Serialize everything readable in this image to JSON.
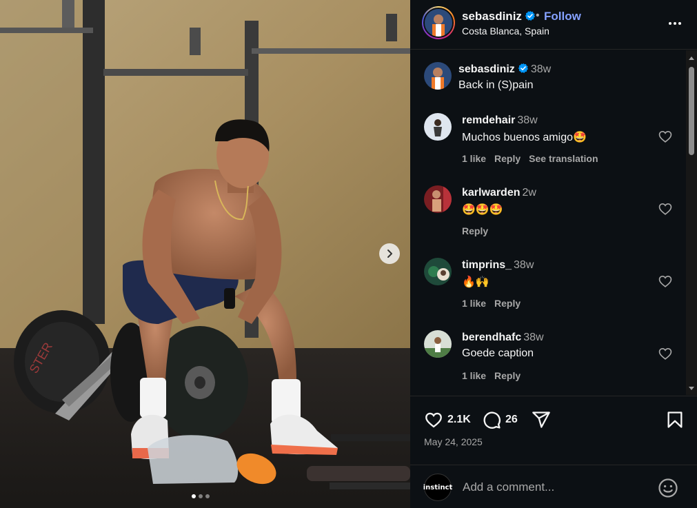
{
  "post": {
    "username": "sebasdiniz",
    "separator": "•",
    "follow_label": "Follow",
    "location": "Costa Blanca, Spain",
    "caption_user": "sebasdiniz",
    "caption_time": "38w",
    "caption_text": "Back in (S)pain",
    "likes": "2.1K",
    "comments_count": "26",
    "date": "May 24, 2025"
  },
  "comments": [
    {
      "user": "remdehair",
      "time": "38w",
      "text": "Muchos buenos amigo🤩",
      "likes": "1 like",
      "reply": "Reply",
      "translate": "See translation"
    },
    {
      "user": "karlwarden",
      "time": "2w",
      "text": "🤩🤩🤩",
      "likes": "",
      "reply": "Reply",
      "translate": ""
    },
    {
      "user": "timprins_",
      "time": "38w",
      "text": "🔥🙌",
      "likes": "1 like",
      "reply": "Reply",
      "translate": ""
    },
    {
      "user": "berendhafc",
      "time": "38w",
      "text": "Goede caption",
      "likes": "1 like",
      "reply": "Reply",
      "translate": ""
    }
  ],
  "composer": {
    "placeholder": "Add a comment...",
    "avatar_text": "instinct"
  },
  "icons": [
    "verified-icon",
    "more-icon",
    "heart-icon",
    "comment-icon",
    "share-icon",
    "save-icon",
    "emoji-icon",
    "chevron-right-icon"
  ],
  "colors": {
    "panel_bg": "#0c1014",
    "follow": "#85a1ff",
    "muted": "#a8a8a8",
    "verified": "#0095f6"
  }
}
